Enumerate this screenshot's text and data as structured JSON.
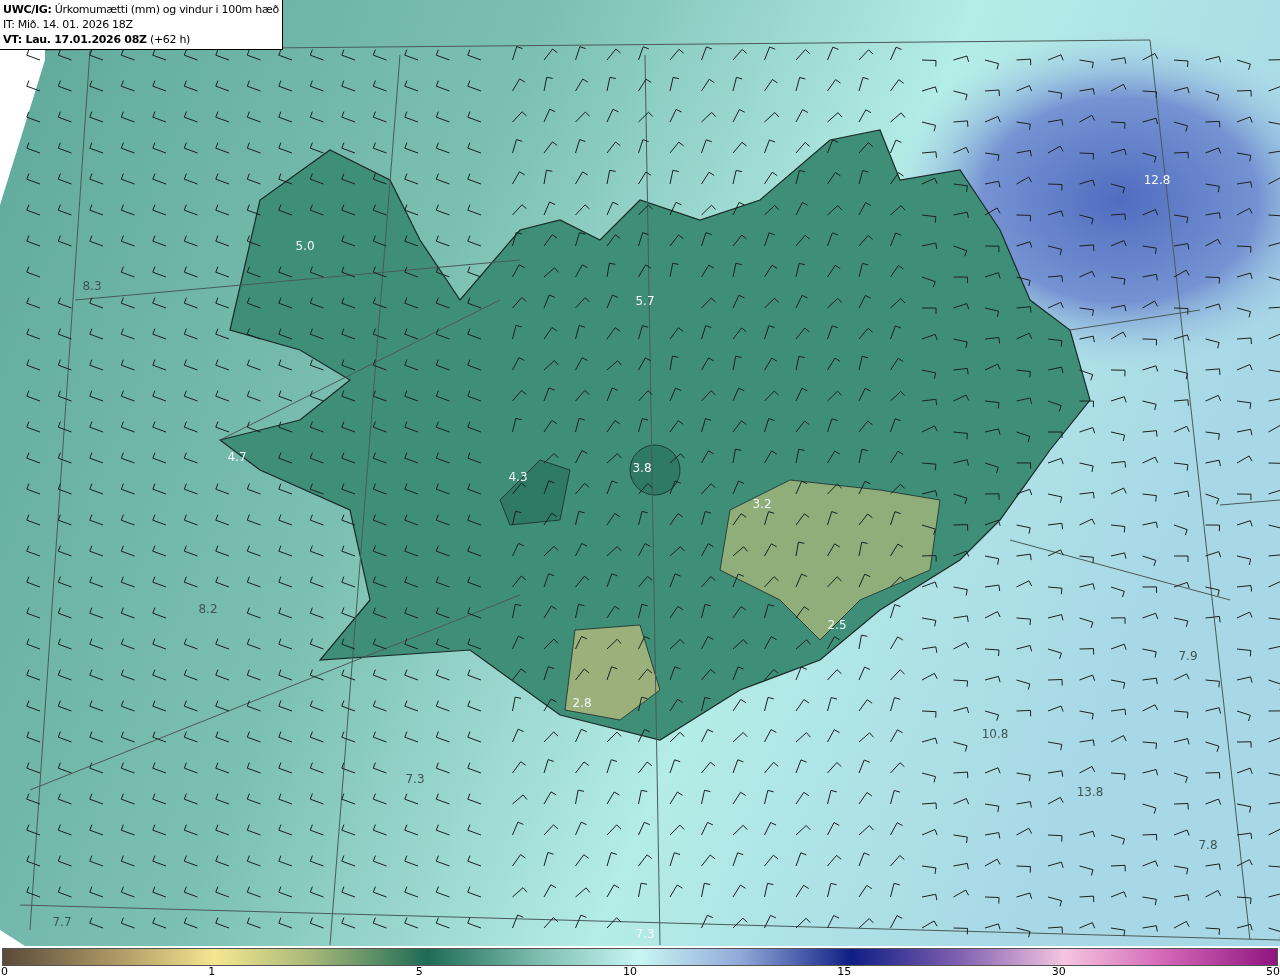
{
  "header": {
    "lines": [
      "**UWC/IG:** Úrkomumætti (mm) og vindur i 100m hæð",
      "IT: Mið. 14. 01. 2026 18Z",
      "**VT: Lau. 17.01.2026 08Z** (+62 h)"
    ]
  },
  "map": {
    "value_labels": [
      {
        "text": "5.0",
        "faint": false
      },
      {
        "text": "8.3",
        "faint": true
      },
      {
        "text": "5.7",
        "faint": false
      },
      {
        "text": "12.8",
        "faint": false
      },
      {
        "text": "4.7",
        "faint": false
      },
      {
        "text": "4.3",
        "faint": false
      },
      {
        "text": "3.8",
        "faint": false
      },
      {
        "text": "3.2",
        "faint": false
      },
      {
        "text": "8.2",
        "faint": true
      },
      {
        "text": "2.5",
        "faint": false
      },
      {
        "text": "2.8",
        "faint": false
      },
      {
        "text": "7.9",
        "faint": true
      },
      {
        "text": "10.8",
        "faint": true
      },
      {
        "text": "7.3",
        "faint": true
      },
      {
        "text": "13.8",
        "faint": true
      },
      {
        "text": "7.8",
        "faint": true
      },
      {
        "text": "7.7",
        "faint": true
      },
      {
        "text": "7.3",
        "faint": false
      }
    ]
  },
  "colorbar": {
    "ticks": [
      "0",
      "1",
      "5",
      "10",
      "15",
      "30",
      "50"
    ]
  }
}
